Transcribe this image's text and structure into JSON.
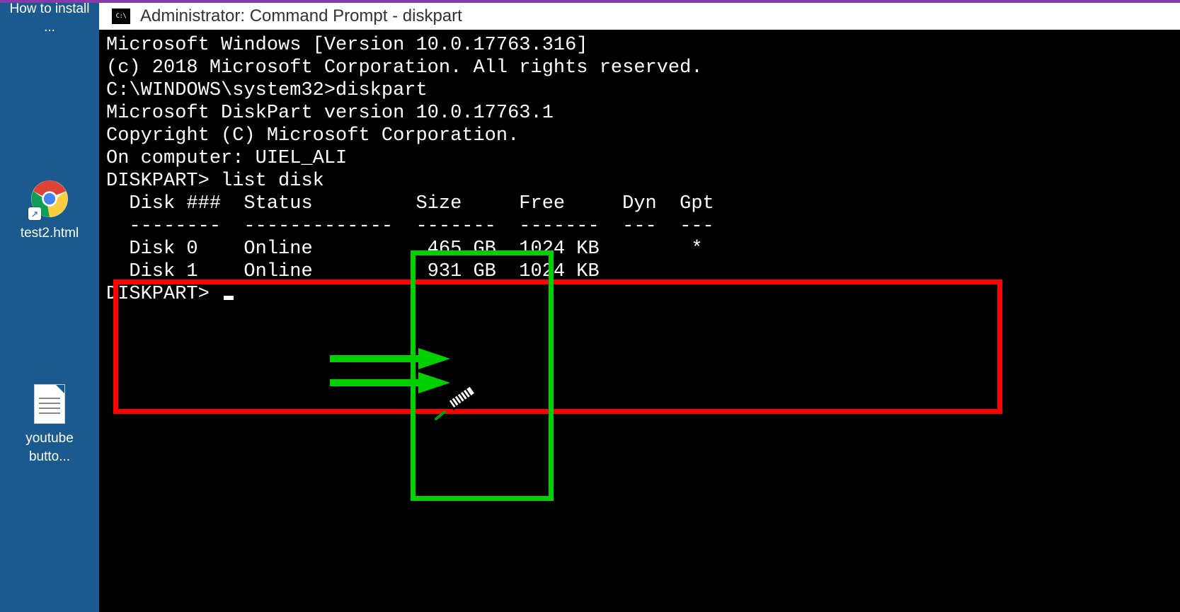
{
  "desktop": {
    "icons": [
      {
        "label": "How to install ..."
      },
      {
        "label": "test2.html"
      },
      {
        "label": "youtube butto..."
      }
    ]
  },
  "cmd": {
    "title": "Administrator: Command Prompt - diskpart",
    "icon_text": "C:\\",
    "lines": {
      "l0": "Microsoft Windows [Version 10.0.17763.316]",
      "l1": "(c) 2018 Microsoft Corporation. All rights reserved.",
      "l2": "",
      "l3": "C:\\WINDOWS\\system32>diskpart",
      "l4": "",
      "l5": "Microsoft DiskPart version 10.0.17763.1",
      "l6": "",
      "l7": "Copyright (C) Microsoft Corporation.",
      "l8": "On computer: UIEL_ALI",
      "l9": "",
      "l10": "DISKPART> list disk",
      "l11": "",
      "l12": "  Disk ###  Status         Size     Free     Dyn  Gpt",
      "l13": "  --------  -------------  -------  -------  ---  ---",
      "l14": "  Disk 0    Online          465 GB  1024 KB        *",
      "l15": "  Disk 1    Online          931 GB  1024 KB",
      "l16": "",
      "l17": "DISKPART> "
    }
  },
  "colors": {
    "desktop_bg": "#1a5a8e",
    "accent_purple": "#8a3aa8",
    "annotation_red": "#ff0000",
    "annotation_green": "#00d000"
  }
}
